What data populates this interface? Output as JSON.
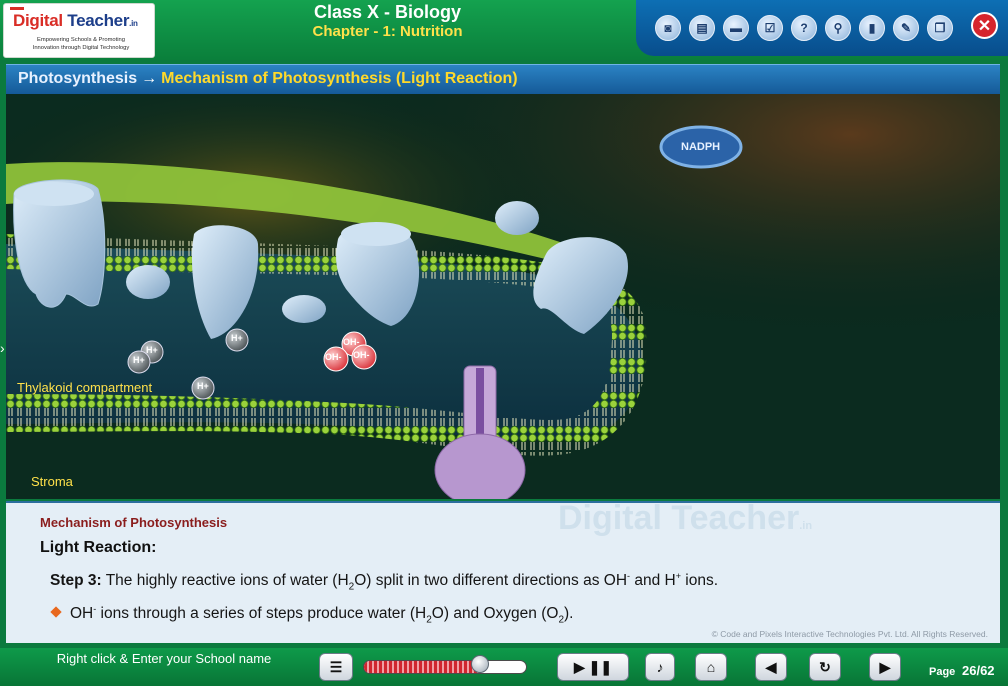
{
  "logo": {
    "brand_part1": "Digital",
    "brand_part2": "Teacher",
    "brand_suffix": ".in",
    "tagline1": "Empowering Schools & Promoting",
    "tagline2": "Innovation through Digital Technology"
  },
  "header": {
    "title": "Class X - Biology",
    "subtitle": "Chapter - 1: Nutrition"
  },
  "toolbar": {
    "icons": [
      "camera-icon",
      "notebook-icon",
      "book-icon",
      "quiz-icon",
      "help-icon",
      "search-icon",
      "glossary-icon",
      "tools-icon",
      "window-icon"
    ],
    "close_icon": "close-icon"
  },
  "breadcrumb": {
    "topic": "Photosynthesis",
    "separator": "→",
    "current": "Mechanism of Photosynthesis (Light Reaction)"
  },
  "stage": {
    "nadph_label": "NADPH",
    "thylakoid_label": "Thylakoid compartment",
    "stroma_label": "Stroma",
    "ion_h": "H+",
    "ion_oh": "OH-"
  },
  "panel": {
    "watermark": "Digital Teacher",
    "watermark_suffix": ".in",
    "section_title": "Mechanism of Photosynthesis",
    "heading": "Light Reaction:",
    "step_label": "Step 3:",
    "step_text_a": " The highly reactive ions of water (H",
    "step_sub1": "2",
    "step_text_b": "O) split in two different directions as OH",
    "step_sup1": "-",
    "step_text_c": " and H",
    "step_sup2": "+",
    "step_text_d": " ions.",
    "bullet_a": "OH",
    "bullet_sup": "-",
    "bullet_b": " ions through a series of steps produce water (H",
    "bullet_sub1": "2",
    "bullet_c": "O) and Oxygen (O",
    "bullet_sub2": "2",
    "bullet_d": ").",
    "copyright": "© Code and Pixels Interactive Technologies  Pvt. Ltd. All Rights Reserved."
  },
  "footer": {
    "school_prompt": "Right click & Enter your School name",
    "progress_fraction": 0.72,
    "page_label": "Page",
    "page_value": "26/62"
  },
  "colors": {
    "header_green": "#0e9a4a",
    "toolbar_blue": "#0d6fb4",
    "breadcrumb_yellow": "#ffd92a",
    "label_yellow": "#ffe14a",
    "section_title": "#8a1d1d"
  }
}
